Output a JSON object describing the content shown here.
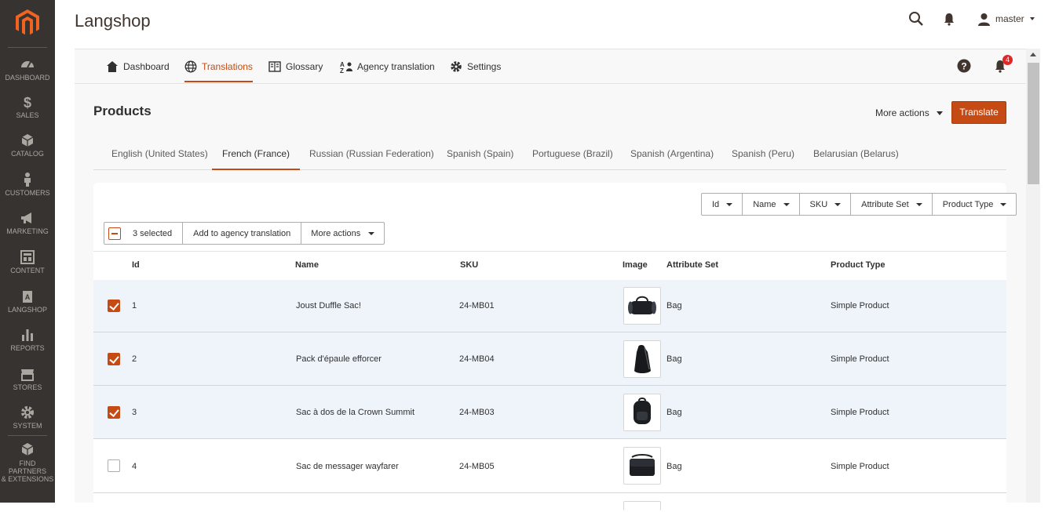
{
  "header": {
    "title": "Langshop",
    "user": "master"
  },
  "sidebar": {
    "items": [
      {
        "label": "DASHBOARD",
        "icon": "dashboard-icon"
      },
      {
        "label": "SALES",
        "icon": "dollar-icon"
      },
      {
        "label": "CATALOG",
        "icon": "cube-icon"
      },
      {
        "label": "CUSTOMERS",
        "icon": "person-icon"
      },
      {
        "label": "MARKETING",
        "icon": "megaphone-icon"
      },
      {
        "label": "CONTENT",
        "icon": "layout-icon"
      },
      {
        "label": "LANGSHOP",
        "icon": "langshop-icon"
      },
      {
        "label": "REPORTS",
        "icon": "bar-chart-icon"
      },
      {
        "label": "STORES",
        "icon": "store-icon"
      },
      {
        "label": "SYSTEM",
        "icon": "gear-icon"
      },
      {
        "label": "FIND PARTNERS",
        "label2": "& EXTENSIONS",
        "icon": "boxes-icon"
      }
    ]
  },
  "nav": {
    "items": [
      {
        "label": "Dashboard",
        "icon": "home-icon"
      },
      {
        "label": "Translations",
        "icon": "globe-icon",
        "active": true
      },
      {
        "label": "Glossary",
        "icon": "book-icon"
      },
      {
        "label": "Agency translation",
        "icon": "agency-icon"
      },
      {
        "label": "Settings",
        "icon": "gear-icon"
      }
    ],
    "notification_count": "4"
  },
  "products": {
    "title": "Products",
    "more_actions": "More actions",
    "translate": "Translate"
  },
  "languages": [
    "English (United States)",
    "French (France)",
    "Russian (Russian Federation)",
    "Spanish (Spain)",
    "Portuguese (Brazil)",
    "Spanish (Argentina)",
    "Spanish (Peru)",
    "Belarusian (Belarus)"
  ],
  "active_language": "French (France)",
  "filters": [
    "Id",
    "Name",
    "SKU",
    "Attribute Set",
    "Product Type"
  ],
  "mass": {
    "selected": "3 selected",
    "agency": "Add to agency translation",
    "more": "More actions"
  },
  "columns": [
    "Id",
    "Name",
    "SKU",
    "Image",
    "Attribute Set",
    "Product Type"
  ],
  "rows": [
    {
      "id": "1",
      "name": "Joust Duffle Sac!",
      "sku": "24-MB01",
      "image": "duffle-bag-image",
      "attribute_set": "Bag",
      "product_type": "Simple Product",
      "checked": true
    },
    {
      "id": "2",
      "name": "Pack d'épaule efforcer",
      "sku": "24-MB04",
      "image": "sling-backpack-image",
      "attribute_set": "Bag",
      "product_type": "Simple Product",
      "checked": true
    },
    {
      "id": "3",
      "name": "Sac à dos de la Crown Summit",
      "sku": "24-MB03",
      "image": "backpack-image",
      "attribute_set": "Bag",
      "product_type": "Simple Product",
      "checked": true
    },
    {
      "id": "4",
      "name": "Sac de messager wayfarer",
      "sku": "24-MB05",
      "image": "messenger-bag-image",
      "attribute_set": "Bag",
      "product_type": "Simple Product",
      "checked": false
    }
  ],
  "colors": {
    "accent": "#c64a13",
    "sidebar": "#373330",
    "selected_row": "#eef4fa"
  }
}
